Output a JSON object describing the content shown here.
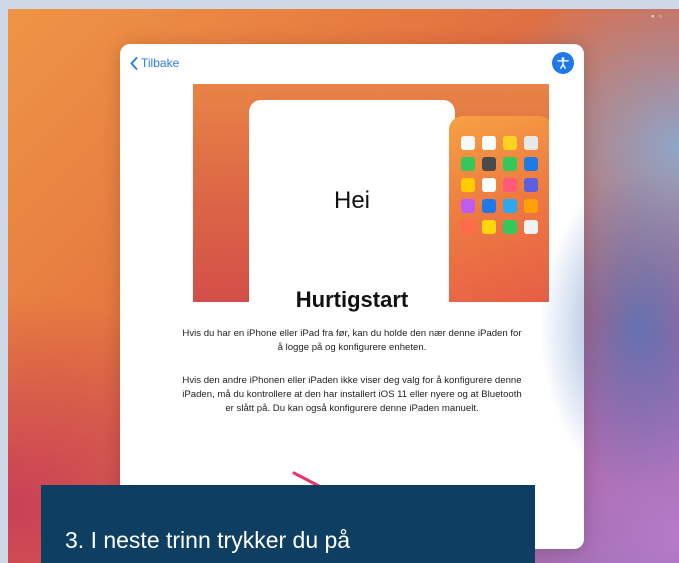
{
  "nav": {
    "back_label": "Tilbake"
  },
  "hero": {
    "greeting": "Hei"
  },
  "content": {
    "title": "Hurtigstart",
    "paragraph_1": "Hvis du har en iPhone eller iPad fra før, kan du holde den nær denne iPaden for å logge på og konfigurere enheten.",
    "paragraph_2": "Hvis den andre iPhonen eller iPaden ikke viser deg valg for å konfigurere denne iPaden, må du kontrollere at den har installert iOS 11 eller nyere og at Bluetooth er slått på. Du kan også konfigurere denne iPaden manuelt."
  },
  "caption": {
    "text": "3. I neste trinn trykker du på"
  },
  "colors": {
    "accent": "#2a7ae4",
    "banner": "#0e3f62",
    "arrow": "#e8336f",
    "app_icons": [
      "#f8f8f8",
      "#ffffff",
      "#ffd21f",
      "#e8e8e8",
      "#35c759",
      "#4a4a4a",
      "#34c759",
      "#1f7ae8",
      "#ffcc00",
      "#ffffff",
      "#ff5a7a",
      "#5b5fe0",
      "#bf5af2",
      "#1f7ae8",
      "#2aa9f0",
      "#ff9f0a",
      "#ff6b4a",
      "#ffd60a",
      "#34c759",
      "#f2f2f2"
    ]
  },
  "icons": {
    "back": "chevron-left-icon",
    "accessibility": "accessibility-icon"
  }
}
